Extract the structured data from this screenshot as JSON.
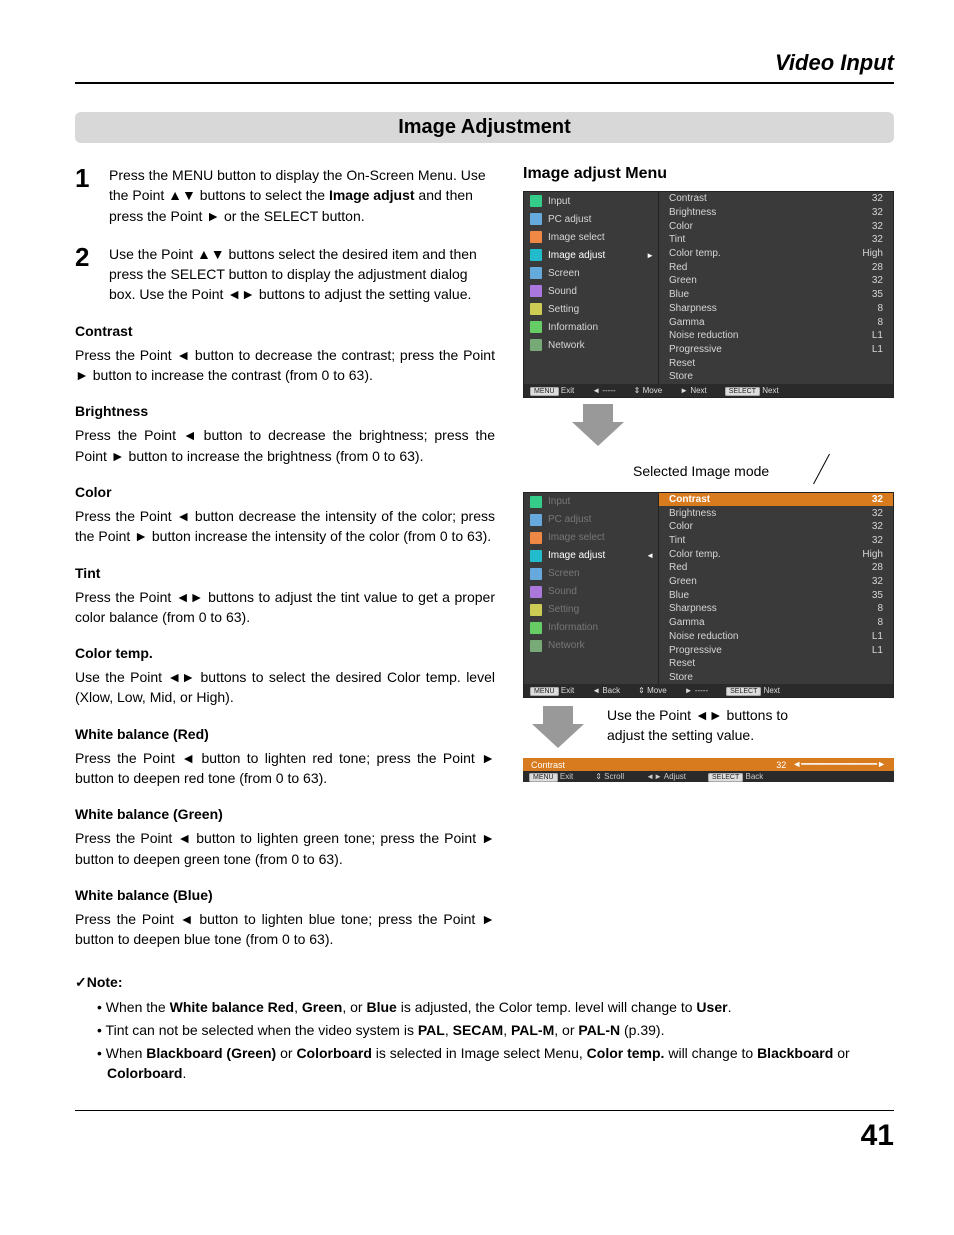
{
  "header": {
    "breadcrumb": "Video Input",
    "section": "Image Adjustment",
    "pageNum": "41"
  },
  "steps": {
    "s1": {
      "num": "1",
      "pre": "Press the MENU button to display the On-Screen Menu. Use the Point ▲▼ buttons to select the ",
      "b1": "Image adjust",
      "post": " and then press the Point ► or the SELECT button."
    },
    "s2": {
      "num": "2",
      "text": "Use the Point ▲▼ buttons select the desired item and then press the SELECT button to display the adjustment dialog box. Use the Point ◄► buttons to adjust the setting value."
    }
  },
  "items": {
    "contrast": {
      "h": "Contrast",
      "t": "Press the Point ◄ button to decrease the contrast; press the Point ► button to increase the contrast (from 0 to 63)."
    },
    "brightness": {
      "h": "Brightness",
      "t": "Press the Point ◄ button to decrease the brightness; press the Point ► button to increase the brightness (from 0 to 63)."
    },
    "color": {
      "h": "Color",
      "t": "Press the Point ◄ button decrease the intensity of the color; press the Point ► button increase the intensity of the color (from 0 to 63)."
    },
    "tint": {
      "h": "Tint",
      "t": "Press the Point ◄► buttons to adjust the tint value to get a proper color balance (from 0 to 63)."
    },
    "ctemp": {
      "h": "Color temp.",
      "t": "Use the Point ◄► buttons to select the desired Color temp. level (Xlow, Low, Mid, or High)."
    },
    "wbr": {
      "h": "White balance (Red)",
      "t": "Press the Point ◄ button to lighten red tone; press the Point ► button to deepen red tone (from 0 to 63)."
    },
    "wbg": {
      "h": "White balance (Green)",
      "t": "Press the Point ◄ button to lighten green tone; press the Point ► button to deepen green tone (from 0 to 63)."
    },
    "wbb": {
      "h": "White balance (Blue)",
      "t": "Press the Point ◄ button to lighten blue tone; press the Point ► button to deepen blue tone (from 0 to 63)."
    }
  },
  "notes": {
    "head": "Note:",
    "n1a": "When the ",
    "n1b": "White balance Red",
    "n1c": ", ",
    "n1d": "Green",
    "n1e": ", or ",
    "n1f": "Blue",
    "n1g": " is adjusted, the Color temp. level will change to ",
    "n1h": "User",
    "n1i": ".",
    "n2a": "Tint can not be selected when the video system is ",
    "n2b": "PAL",
    "n2c": ", ",
    "n2d": "SECAM",
    "n2e": ", ",
    "n2f": "PAL-M",
    "n2g": ", or ",
    "n2h": "PAL-N",
    "n2i": " (p.39).",
    "n3a": "When ",
    "n3b": "Blackboard (Green)",
    "n3c": " or ",
    "n3d": "Colorboard",
    "n3e": " is selected in Image select Menu, ",
    "n3f": "Color temp.",
    "n3g": " will change to ",
    "n3h": "Blackboard",
    "n3i": " or ",
    "n3j": "Colorboard",
    "n3k": "."
  },
  "right": {
    "title": "Image adjust Menu",
    "menuLeft": [
      "Input",
      "PC adjust",
      "Image select",
      "Image adjust",
      "Screen",
      "Sound",
      "Setting",
      "Information",
      "Network"
    ],
    "menuRight": [
      {
        "l": "Contrast",
        "v": "32"
      },
      {
        "l": "Brightness",
        "v": "32"
      },
      {
        "l": "Color",
        "v": "32"
      },
      {
        "l": "Tint",
        "v": "32"
      },
      {
        "l": "Color temp.",
        "v": "High"
      },
      {
        "l": "Red",
        "v": "28"
      },
      {
        "l": "Green",
        "v": "32"
      },
      {
        "l": "Blue",
        "v": "35"
      },
      {
        "l": "Sharpness",
        "v": "8"
      },
      {
        "l": "Gamma",
        "v": "8"
      },
      {
        "l": "Noise reduction",
        "v": "L1"
      },
      {
        "l": "Progressive",
        "v": "L1"
      },
      {
        "l": "Reset",
        "v": ""
      },
      {
        "l": "Store",
        "v": ""
      }
    ],
    "footer1": {
      "exit": "Exit",
      "left": "-----",
      "move": "Move",
      "next": "Next",
      "sel": "Next",
      "menu": "MENU",
      "select": "SELECT"
    },
    "selectedLabel": "Selected Image mode",
    "caption": "Use the Point ◄► buttons to adjust the setting value.",
    "footer2": {
      "exit": "Exit",
      "back": "Back",
      "move": "Move",
      "dash": "-----",
      "next": "Next"
    },
    "mini": {
      "label": "Contrast",
      "val": "32",
      "exit": "Exit",
      "scroll": "Scroll",
      "adjust": "Adjust",
      "back": "Back",
      "menu": "MENU",
      "select": "SELECT"
    }
  }
}
